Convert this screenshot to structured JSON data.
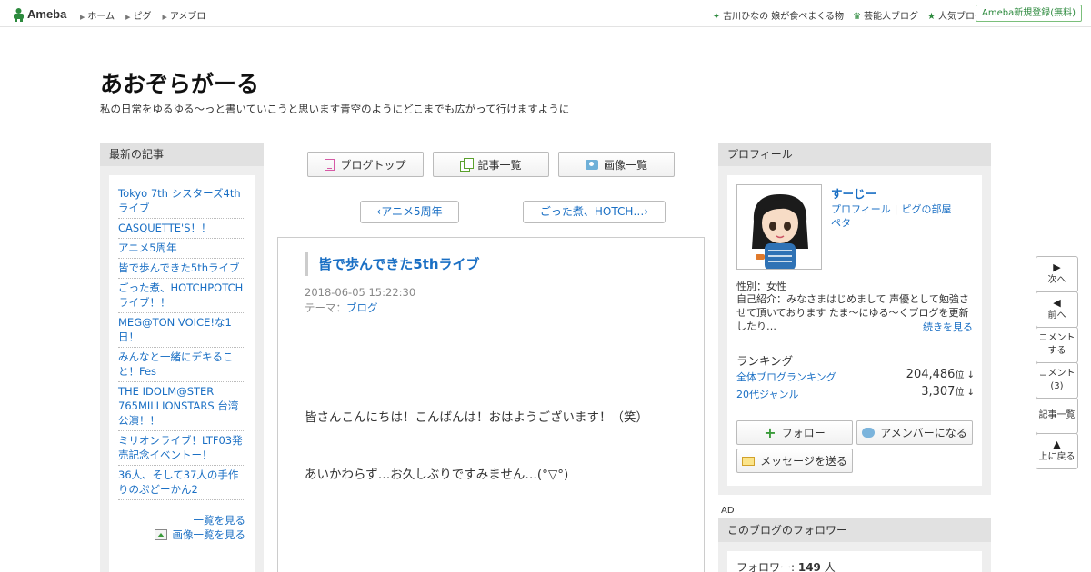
{
  "topbar": {
    "logo": "Ameba",
    "nav": [
      "ホーム",
      "ピグ",
      "アメブロ"
    ],
    "right_links": [
      "吉川ひなの 娘が食べまくる物",
      "芸能人ブログ",
      "人気ブログ"
    ],
    "register": "Ameba新規登録(無料)"
  },
  "blog": {
    "title": "あおぞらがーる",
    "description": "私の日常をゆるゆる～っと書いていこうと思います青空のようにどこまでも広がって行けますように"
  },
  "left": {
    "heading": "最新の記事",
    "recent": [
      "Tokyo 7th シスターズ4thライブ",
      "CASQUETTE'S！！",
      "アニメ5周年",
      "皆で歩んできた5thライブ",
      "ごった煮、HOTCHPOTCHライブ！！",
      "MEG@TON VOICE!な1日！",
      "みんなと一緒にデキること！Fes",
      "THE IDOLM@STER 765MILLIONSTARS 台湾公演！！",
      "ミリオンライブ！LTF03発売記念イベントー！",
      "36人、そして37人の手作りのぷどーかん2"
    ],
    "see_all": "一覧を見る",
    "see_images": "画像一覧を見る"
  },
  "center": {
    "buttons": [
      "ブログトップ",
      "記事一覧",
      "画像一覧"
    ],
    "prev": "アニメ5周年",
    "next": "ごった煮、HOTCH…",
    "entry": {
      "title": "皆で歩んできた5thライブ",
      "date": "2018-06-05 15:22:30",
      "theme_label": "テーマ：",
      "theme": "ブログ",
      "lines": [
        "皆さんこんにちは！こんばんは！おはようございます！（笑）",
        "あいかわらず…お久しぶりですみません…(°▽°)"
      ]
    }
  },
  "profile": {
    "heading": "プロフィール",
    "name": "すーじー",
    "links": [
      "プロフィール",
      "ピグの部屋",
      "ペタ"
    ],
    "gender": "性別：女性",
    "intro": "自己紹介：みなさまはじめまして 声優として勉強させて頂いております たま～にゆる～くブログを更新したり…",
    "more": "続きを見る",
    "ranking_title": "ランキング",
    "rankings": [
      {
        "label": "全体ブログランキング",
        "value": "204,486",
        "unit": "位"
      },
      {
        "label": "20代ジャンル",
        "value": "3,307",
        "unit": "位"
      }
    ],
    "follow": "フォロー",
    "member": "アメンバーになる",
    "message": "メッセージを送る"
  },
  "ad": "AD",
  "followers": {
    "heading": "このブログのフォロワー",
    "label": "フォロワー: ",
    "count": "149",
    "unit": " 人"
  },
  "sidenav": {
    "next": "次へ",
    "prev": "前へ",
    "comment_do": [
      "コメント",
      "する"
    ],
    "comment_count": [
      "コメント",
      "(3)"
    ],
    "articles": "記事一覧",
    "top": [
      "上に戻る"
    ]
  },
  "colors": {
    "link": "#1a6fc4",
    "brand_green": "#2d8a3e"
  }
}
